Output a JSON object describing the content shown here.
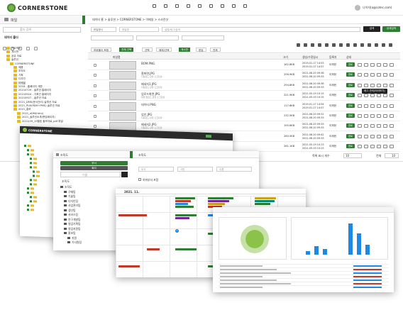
{
  "main": {
    "logo_text": "CORNERSTONE",
    "user_text": "나이자(a@cotec.com)",
    "sidebar_tab": "파일",
    "search_placeholder": "폴더 검색",
    "folder_header": "데이터 폴더",
    "breadcrumb": "데이터 홈 > 솔루션 > CORNERSTONE > 이메일 > 스크린샷",
    "filter_labels": [
      "파일형식",
      "파일명",
      "설명/태그/검색"
    ],
    "search_button": "검색",
    "detail_button": "상세검색",
    "toolbar_tabs": [
      "하위폴더 포함",
      "전체 선택",
      "선택",
      "해제/선택",
      "게시판",
      "편집",
      "전체"
    ],
    "columns": [
      "파일명",
      "크기",
      "생성/수정일시",
      "등록자",
      "상태"
    ],
    "tree": [
      {
        "label": "프로젝트",
        "level": 1
      },
      {
        "label": "게시판",
        "level": 1
      },
      {
        "label": "공유 자료",
        "level": 1
      },
      {
        "label": "솔루션",
        "level": 1
      },
      {
        "label": "CORNERSTONE",
        "level": 2
      },
      {
        "label": "제품",
        "level": 3
      },
      {
        "label": "조직도",
        "level": 3
      },
      {
        "label": "기획",
        "level": 3
      },
      {
        "label": "디자인",
        "level": 3
      },
      {
        "label": "이메일",
        "level": 3
      },
      {
        "label": "2018 - 홈페이지 개편",
        "level": 3
      },
      {
        "label": "20210729 - 솔루션 홈페이지",
        "level": 3
      },
      {
        "label": "20210924 - 기록관 홈페이지",
        "level": 3
      },
      {
        "label": "20210927 - 솔루션 자료",
        "level": 3
      },
      {
        "label": "2021_DMS(문서관리) 솔루션 자료",
        "level": 3
      },
      {
        "label": "2021_PLM(PDM+PMS) 솔루션 자료",
        "level": 3
      },
      {
        "label": "2021_홍보",
        "level": 3
      },
      {
        "label": "2021_eDM(html)",
        "level": 4
      },
      {
        "label": "2021_솔루션소개(랜딩페이지)",
        "level": 4
      },
      {
        "label": "2021(09_10월호 홍보자료_pdf 파일",
        "level": 4
      }
    ],
    "files": [
      {
        "name": "BOM.PNG",
        "desc": "",
        "size": "162.8KB",
        "date1": "2019-01-17 14:53",
        "date2": "2019-01-17 14:57",
        "user": "이재현",
        "status": "완료"
      },
      {
        "name": "홈화면.JPG",
        "desc": "다운로드 관련 스크린샷",
        "size": "256.9KB",
        "date1": "2021-08-20 09:36",
        "date2": "2021-08-20 09:33",
        "user": "이재현",
        "status": "완료"
      },
      {
        "name": "메세지1.JPG",
        "desc": "다운로드 관련 스크린샷",
        "size": "294.8KB",
        "date1": "2021-08-20 09:36",
        "date2": "2021-08-20 09:33",
        "user": "이재현",
        "status": "완료"
      },
      {
        "name": "업로드화면.JPG",
        "desc": "화면 업로드 관련 스크린샷",
        "size": "221.9KB",
        "date1": "2021-05-19 10:15",
        "date2": "2021-05-19 10:15",
        "user": "이재현",
        "status": "완료"
      },
      {
        "name": "데이터.PNG",
        "desc": "",
        "size": "117.6KB",
        "date1": "2019-01-17 14:54",
        "date2": "2019-01-17 14:57",
        "user": "이재현",
        "status": "완료"
      },
      {
        "name": "업인.JPG",
        "desc": "다운로드 관련 스크린샷",
        "size": "232.5KB",
        "date1": "2021-08-20 09:31",
        "date2": "2021-08-20 09:33",
        "user": "이재현",
        "status": "완료"
      },
      {
        "name": "메세지2.JPG",
        "desc": "다운로드 관련 스크린샷",
        "size": "195.6KB",
        "date1": "2021-08-20 09:33",
        "date2": "2021-08-20 09:33",
        "user": "이재현",
        "status": "완료"
      },
      {
        "name": "홈.JPG",
        "desc": "다운로드 관련 스크린샷",
        "size": "280.5KB",
        "date1": "2021-08-20 09:42",
        "date2": "2021-08-20 09:33",
        "user": "이재현",
        "status": "완료"
      },
      {
        "name": "상세.JPG",
        "desc": "",
        "size": "261.1KB",
        "date1": "2021-05-19 10:13",
        "date2": "2021-05-19 10:13",
        "user": "이재현",
        "status": "완료"
      }
    ],
    "tooltip": "태그 관리(미리보기)",
    "pagination": {
      "label": "목록 표시 개수",
      "count": "10",
      "total_label": "전체",
      "total": "10"
    }
  },
  "org": {
    "logo_text": "CORNERSTONE",
    "tab_label": "조직도",
    "tab_label2": "조직도",
    "side_buttons": [
      "부서",
      "회사"
    ],
    "search_placeholder": "이름",
    "root": "조직도",
    "nodes": [
      "조직도",
      "구매팀",
      "기술팀",
      "디자인팀",
      "사업관리팀",
      "생산팀",
      "서비스팀",
      "연구개발팀",
      "영업기획팀",
      "영업지원팀",
      "홍보팀",
      "지원",
      "기사원팀"
    ],
    "filter_placeholders": [
      "부서",
      "사번",
      "이름"
    ],
    "checkbox_label": "하위부서 포함"
  },
  "calendar": {
    "title": "2021. 11.",
    "today": "7"
  },
  "colors": {
    "green": "#2e7d32",
    "dark": "#2b2b2b",
    "lime": "#8bc34a",
    "red": "#c0392b",
    "blue": "#1e88e5",
    "teal": "#00897b",
    "purple": "#7b1fa2",
    "gold": "#c7a21a"
  }
}
